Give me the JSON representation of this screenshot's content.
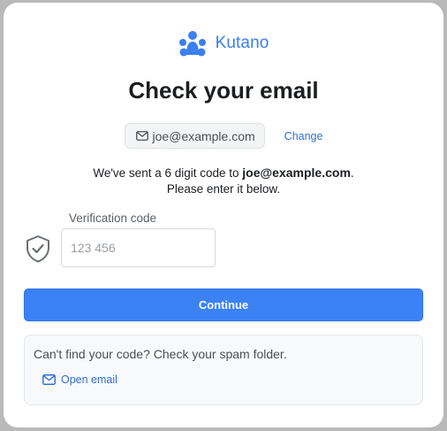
{
  "brand": {
    "name": "Kutano",
    "icon": "people-group-icon",
    "color": "#3b7ff0"
  },
  "page": {
    "title": "Check your email"
  },
  "email_chip": {
    "email": "joe@example.com",
    "icon": "mail-icon"
  },
  "change_link": {
    "label": "Change"
  },
  "message": {
    "prefix": "We've sent a 6 digit code to",
    "email": "joe@example.com",
    "suffix": ".",
    "line2": "Please enter it below."
  },
  "verification": {
    "label": "Verification code",
    "placeholder": "123 456",
    "value": "",
    "icon": "shield-check-icon"
  },
  "continue_button": {
    "label": "Continue",
    "color": "#3b82f6"
  },
  "help": {
    "text": "Can't find your code? Check your spam folder.",
    "open_email_label": "Open email",
    "icon": "mail-icon"
  }
}
